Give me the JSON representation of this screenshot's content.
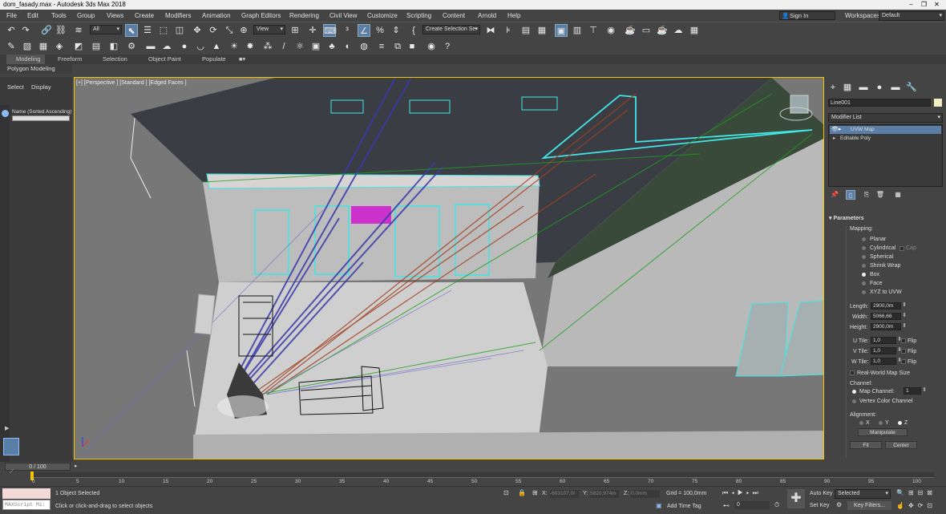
{
  "window": {
    "title": "dom_fasady.max - Autodesk 3ds Max 2018",
    "minimize": "–",
    "maximize": "❐",
    "close": "✕"
  },
  "menu": [
    "File",
    "Edit",
    "Tools",
    "Group",
    "Views",
    "Create",
    "Modifiers",
    "Animation",
    "Graph Editors",
    "Rendering",
    "Civil View",
    "Customize",
    "Scripting",
    "Content",
    "Arnold",
    "Help"
  ],
  "signin": "Sign In",
  "workspaces_label": "Workspaces:",
  "workspaces_value": "Default",
  "toolbar": {
    "selection_filter": "All",
    "ref_coord": "View",
    "named_selection": "Create Selection Se"
  },
  "ribbon_tabs": [
    "Modeling",
    "Freeform",
    "Selection",
    "Object Paint",
    "Populate"
  ],
  "polygon_modeling": "Polygon Modeling",
  "scene_explorer": {
    "tabs": [
      "Select",
      "Display"
    ],
    "column": "Name (Sorted Ascending)"
  },
  "viewport": {
    "label": "[+] [Perspective ] [Standard ] [Edged Faces ]"
  },
  "command_panel": {
    "object_name": "Line001",
    "modifier_list": "Modifier List",
    "stack": [
      "UVW Map",
      "Editable Poly"
    ],
    "rollout": "Parameters",
    "mapping_label": "Mapping:",
    "mapping_options": [
      "Planar",
      "Cylindrical",
      "Spherical",
      "Shrink Wrap",
      "Box",
      "Face",
      "XYZ to UVW"
    ],
    "mapping_selected": "Box",
    "cap_label": "Cap",
    "length_label": "Length:",
    "length": "2900,0m",
    "width_label": "Width:",
    "width": "5066,66",
    "height_label": "Height:",
    "height": "2900,0m",
    "utile_label": "U Tile:",
    "utile": "1,0",
    "vtile_label": "V Tile:",
    "vtile": "1,0",
    "wtile_label": "W Tile:",
    "wtile": "1,0",
    "flip_label": "Flip",
    "real_world": "Real-World Map Size",
    "channel_label": "Channel:",
    "map_channel_label": "Map Channel:",
    "map_channel": "1",
    "vertex_color_channel": "Vertex Color Channel",
    "alignment_label": "Alignment:",
    "axes": [
      "X",
      "Y",
      "Z"
    ],
    "axis_selected": "Z",
    "manipulate": "Manipulate",
    "fit": "Fit",
    "center": "Center"
  },
  "timeline": {
    "frame": "0 / 100",
    "ticks": [
      "0",
      "5",
      "10",
      "15",
      "20",
      "25",
      "30",
      "35",
      "40",
      "45",
      "50",
      "55",
      "60",
      "65",
      "70",
      "75",
      "80",
      "85",
      "90",
      "95",
      "100"
    ]
  },
  "status": {
    "maxscript": "MAXScript Mi:",
    "selected": "1 Object Selected",
    "prompt": "Click or click-and-drag to select objects",
    "x_label": "X:",
    "x": "-603107,0r",
    "y_label": "Y:",
    "y": "5820,974m",
    "z_label": "Z:",
    "z": "0,0mm",
    "grid": "Grid = 100,0mm",
    "add_time_tag": "Add Time Tag",
    "auto_key": "Auto Key",
    "set_key": "Set Key",
    "key_mode": "Selected",
    "key_filters": "Key Filters...",
    "current_frame": "0"
  }
}
